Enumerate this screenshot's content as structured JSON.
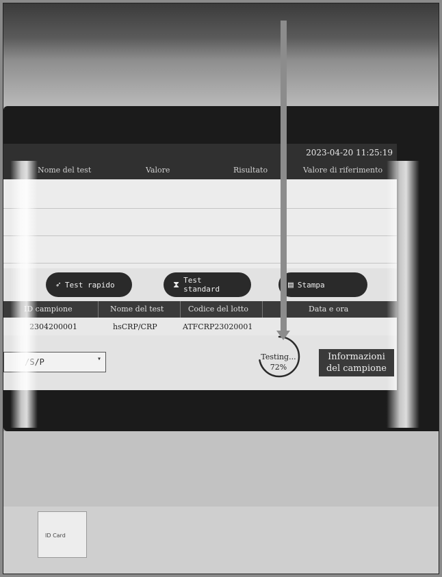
{
  "header": {
    "datetime": "2023-04-20 11:25:19",
    "columns": [
      "Nome del test",
      "Valore",
      "Risultato",
      "Valore di riferimento"
    ]
  },
  "actions": {
    "rapid_test": "Test rapido",
    "standard_test": "Test standard",
    "print": "Stampa"
  },
  "sample_table": {
    "columns": [
      "ID campione",
      "Nome del test",
      "Codice del lotto",
      "Data e ora"
    ],
    "rows": [
      [
        "2304200001",
        "hsCRP/CRP",
        "ATFCRP23020001",
        ""
      ]
    ]
  },
  "sample_type_select": {
    "value": "/S/P"
  },
  "status": {
    "label": "Testing...",
    "percent_text": "72%",
    "progress": 0.72
  },
  "info_button": {
    "line1": "Informazioni",
    "line2": "del campione"
  },
  "device": {
    "id_card_label": "ID Card"
  },
  "icons": {
    "rapid_test": "rocket-icon",
    "standard_test": "hourglass-icon",
    "print": "printer-icon"
  }
}
